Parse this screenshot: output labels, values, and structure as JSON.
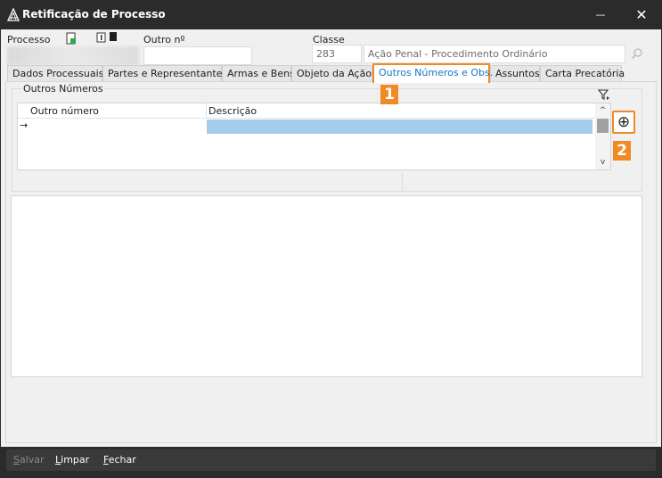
{
  "window": {
    "title": "Retificação de Processo",
    "minimize_glyph": "—",
    "close_glyph": "✕",
    "accent_color": "#f08a24",
    "link_color": "#1a74c4",
    "selection_color": "#a4cdec"
  },
  "header": {
    "processo_label": "Processo",
    "outro_label": "Outro nº",
    "classe_label": "Classe",
    "classe_code": "283",
    "classe_desc": "Ação Penal - Procedimento Ordinário",
    "icons": [
      "document-status-icon",
      "info-icon",
      "square-icon",
      "search-icon"
    ]
  },
  "tabs": [
    {
      "label": "Dados Processuais",
      "active": false
    },
    {
      "label": "Partes e Representantes",
      "active": false
    },
    {
      "label": "Armas e Bens",
      "active": false
    },
    {
      "label": "Objeto da Ação",
      "active": false
    },
    {
      "label": "Outros Números e Obs.",
      "active": true
    },
    {
      "label": "Assuntos",
      "active": false
    },
    {
      "label": "Carta Precatória",
      "active": false
    }
  ],
  "outros_numeros": {
    "legend": "Outros Números",
    "columns": [
      "Outro número",
      "Descrição"
    ],
    "row_indicator": "→",
    "scroll_up": "^",
    "scroll_down": "v",
    "add_glyph": "⊕"
  },
  "callouts": [
    "1",
    "2"
  ],
  "footer": {
    "salvar_first": "S",
    "salvar_rest": "alvar",
    "limpar_first": "L",
    "limpar_rest": "impar",
    "fechar_first": "F",
    "fechar_rest": "echar"
  }
}
